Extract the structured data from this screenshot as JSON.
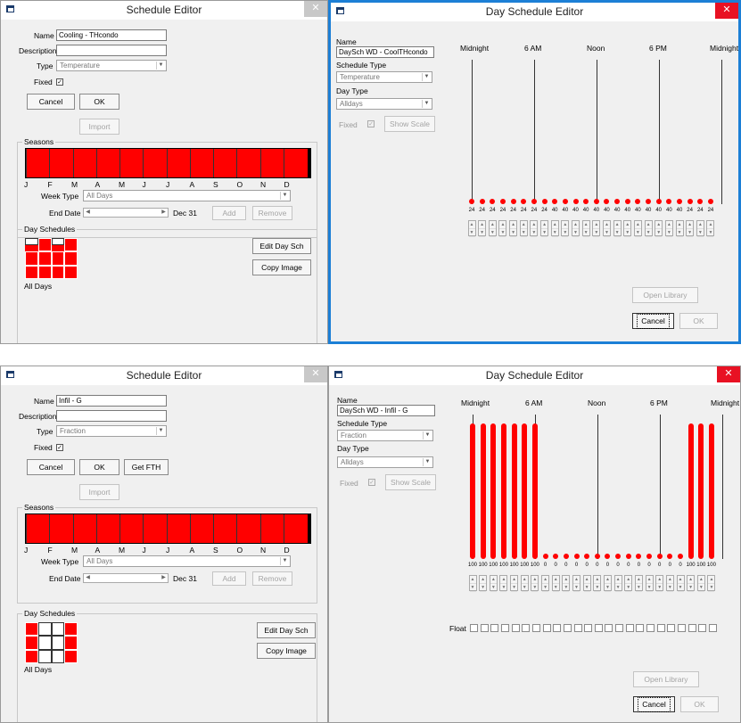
{
  "colors": {
    "schedule_red": "#ff0000",
    "win_border_blue": "#1c7fd6",
    "close_red": "#e81123"
  },
  "top": {
    "schedule_editor": {
      "title": "Schedule Editor",
      "close_symbol": "✕",
      "name_label": "Name",
      "name_value": "Cooling - THcondo",
      "description_label": "Description",
      "description_value": "",
      "type_label": "Type",
      "type_value": "Temperature",
      "fixed_label": "Fixed",
      "fixed_checked": "✓",
      "buttons": {
        "cancel": "Cancel",
        "ok": "OK",
        "import": "Import"
      },
      "seasons_label": "Seasons",
      "months": [
        "J",
        "F",
        "M",
        "A",
        "M",
        "J",
        "J",
        "A",
        "S",
        "O",
        "N",
        "D"
      ],
      "week_type_label": "Week Type",
      "week_type_value": "All Days",
      "end_date_label": "End Date",
      "end_date_value": "Dec 31",
      "add_label": "Add",
      "remove_label": "Remove",
      "day_schedules_label": "Day Schedules",
      "edit_day_sch": "Edit Day Sch",
      "copy_image": "Copy Image",
      "all_days_label": "All Days"
    },
    "day_schedule_editor": {
      "title": "Day Schedule Editor",
      "close_symbol": "✕",
      "name_label": "Name",
      "name_value": "DaySch WD - CoolTHcondo",
      "schedule_type_label": "Schedule Type",
      "schedule_type_value": "Temperature",
      "day_type_label": "Day Type",
      "day_type_value": "Alldays",
      "fixed_label": "Fixed",
      "fixed_checked": "✓",
      "show_scale": "Show Scale",
      "time_labels": [
        "Midnight",
        "6 AM",
        "Noon",
        "6 PM",
        "Midnight"
      ],
      "values": [
        24,
        24,
        24,
        24,
        24,
        24,
        24,
        24,
        40,
        40,
        40,
        40,
        40,
        40,
        40,
        40,
        40,
        40,
        40,
        40,
        40,
        24,
        24,
        24
      ],
      "value_labels": [
        "24",
        "24",
        "24",
        "24",
        "24",
        "24",
        "24",
        "24",
        "40",
        "40",
        "40",
        "40",
        "40",
        "40",
        "40",
        "40",
        "40",
        "40",
        "40",
        "40",
        "40",
        "24",
        "24",
        "24"
      ],
      "max_value": 100,
      "open_library": "Open Library",
      "cancel": "Cancel",
      "ok": "OK"
    }
  },
  "bottom": {
    "schedule_editor": {
      "title": "Schedule Editor",
      "close_symbol": "✕",
      "name_label": "Name",
      "name_value": "Infil - G",
      "description_label": "Description",
      "description_value": "",
      "type_label": "Type",
      "type_value": "Fraction",
      "fixed_label": "Fixed",
      "fixed_checked": "✓",
      "buttons": {
        "cancel": "Cancel",
        "ok": "OK",
        "get_fth": "Get FTH",
        "import": "Import"
      },
      "seasons_label": "Seasons",
      "months": [
        "J",
        "F",
        "M",
        "A",
        "M",
        "J",
        "J",
        "A",
        "S",
        "O",
        "N",
        "D"
      ],
      "week_type_label": "Week Type",
      "week_type_value": "All Days",
      "end_date_label": "End Date",
      "end_date_value": "Dec 31",
      "add_label": "Add",
      "remove_label": "Remove",
      "day_schedules_label": "Day Schedules",
      "edit_day_sch": "Edit Day Sch",
      "copy_image": "Copy Image",
      "all_days_label": "All Days"
    },
    "day_schedule_editor": {
      "title": "Day Schedule Editor",
      "close_symbol": "✕",
      "name_label": "Name",
      "name_value": "DaySch WD - Infil - G",
      "schedule_type_label": "Schedule Type",
      "schedule_type_value": "Fraction",
      "day_type_label": "Day Type",
      "day_type_value": "Alldays",
      "fixed_label": "Fixed",
      "fixed_checked": "✓",
      "show_scale": "Show Scale",
      "time_labels": [
        "Midnight",
        "6 AM",
        "Noon",
        "6 PM",
        "Midnight"
      ],
      "values": [
        100,
        100,
        100,
        100,
        100,
        100,
        100,
        0,
        0,
        0,
        0,
        0,
        0,
        0,
        0,
        0,
        0,
        0,
        0,
        0,
        0,
        100,
        100,
        100
      ],
      "value_labels": [
        "100",
        "100",
        "100",
        "100",
        "100",
        "100",
        "100",
        "0",
        "0",
        "0",
        "0",
        "0",
        "0",
        "0",
        "0",
        "0",
        "0",
        "0",
        "0",
        "0",
        "0",
        "100",
        "100",
        "100"
      ],
      "max_value": 100,
      "float_label": "Float",
      "open_library": "Open Library",
      "cancel": "Cancel",
      "ok": "OK"
    }
  }
}
